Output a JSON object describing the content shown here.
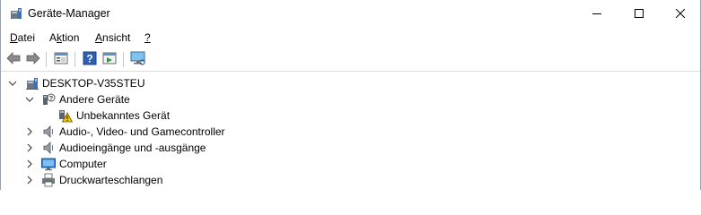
{
  "window": {
    "title": "Geräte-Manager",
    "app_icon": "device-manager-icon",
    "caption_buttons": [
      "minimize-icon",
      "maximize-icon",
      "close-icon"
    ]
  },
  "menu": {
    "items": [
      {
        "label": "Datei",
        "accel": "D",
        "rest": "atei"
      },
      {
        "label": "Aktion",
        "accel_prefix": "A",
        "accel": "k",
        "rest": "tion"
      },
      {
        "label": "Ansicht",
        "accel": "A",
        "rest": "nsicht"
      },
      {
        "label": "?",
        "accel": "?",
        "rest": ""
      }
    ]
  },
  "toolbar": {
    "buttons": [
      {
        "icon": "back-arrow-icon"
      },
      {
        "icon": "forward-arrow-icon"
      },
      {
        "icon": "properties-icon"
      },
      {
        "icon": "help-icon"
      },
      {
        "icon": "update-driver-icon"
      },
      {
        "icon": "scan-hardware-icon"
      }
    ]
  },
  "tree": {
    "root": {
      "label": "DESKTOP-V35STEU",
      "icon": "computer-tree-icon",
      "expanded": true
    },
    "items": [
      {
        "label": "Andere Geräte",
        "icon": "unknown-device-icon",
        "expanded": true,
        "level": 1
      },
      {
        "label": "Unbekanntes Gerät",
        "icon": "warning-device-icon",
        "level": 2
      },
      {
        "label": "Audio-, Video- und Gamecontroller",
        "icon": "speaker-icon",
        "expanded": false,
        "level": 1
      },
      {
        "label": "Audioeingänge und -ausgänge",
        "icon": "speaker-icon",
        "expanded": false,
        "level": 1
      },
      {
        "label": "Computer",
        "icon": "monitor-icon",
        "expanded": false,
        "level": 1
      },
      {
        "label": "Druckwarteschlangen",
        "icon": "printer-icon",
        "expanded": false,
        "level": 1
      }
    ]
  },
  "colors": {
    "accent": "#2f7fd3",
    "warning": "#f5c400",
    "arrow": "#606060"
  }
}
